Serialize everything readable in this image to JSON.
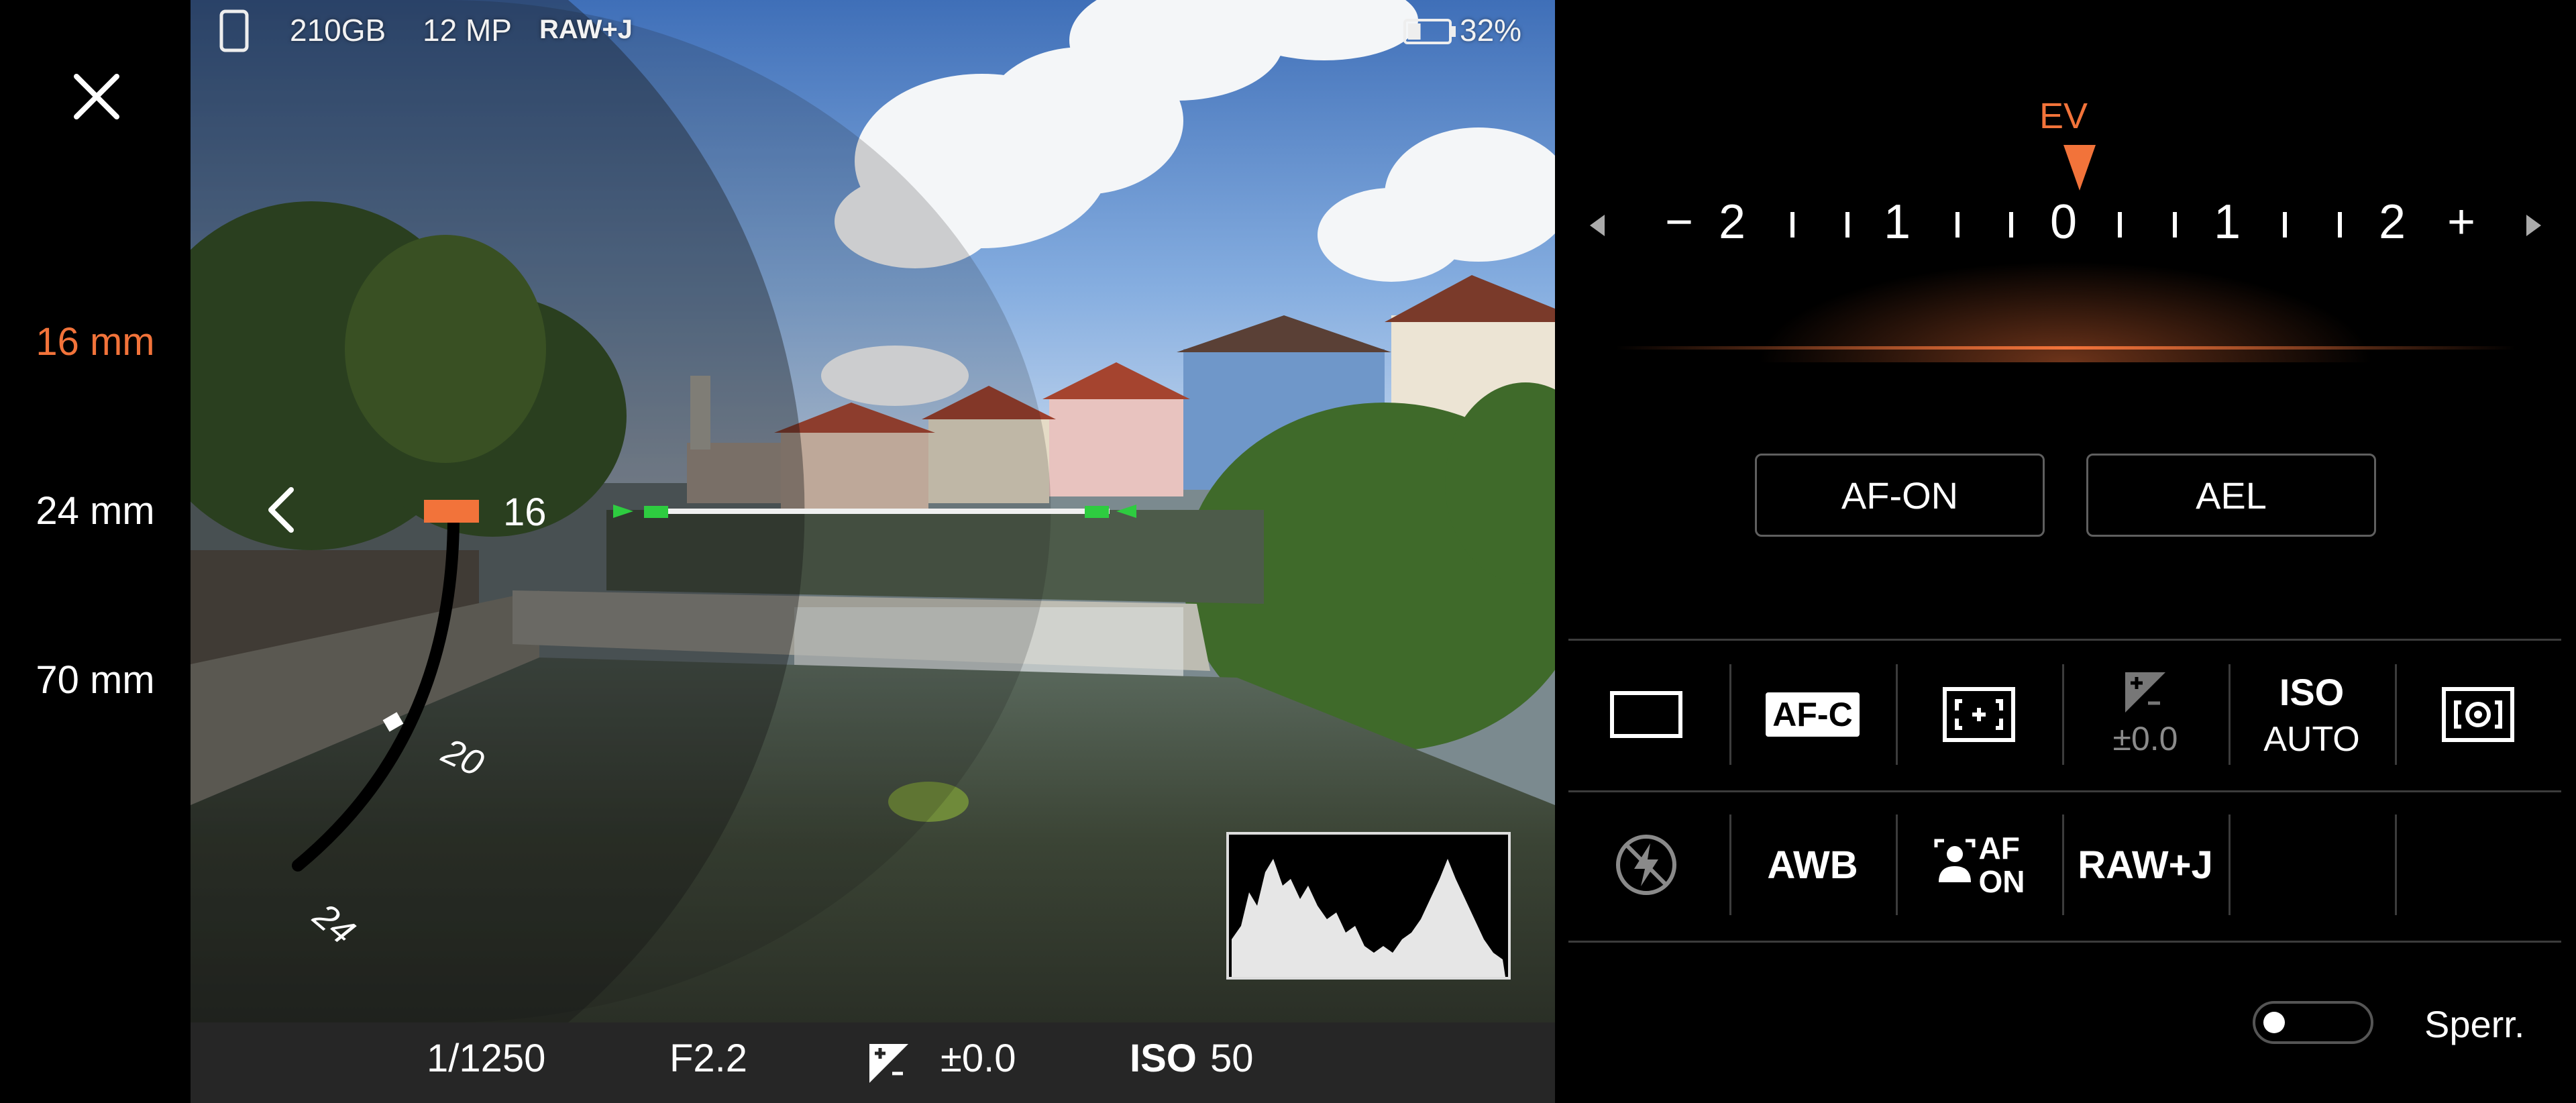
{
  "left_rail": {
    "close_icon": "close-icon",
    "focal_lengths": [
      {
        "label": "16 mm",
        "active": true
      },
      {
        "label": "24 mm",
        "active": false
      },
      {
        "label": "70 mm",
        "active": false
      }
    ]
  },
  "status": {
    "storage": "210GB",
    "resolution": "12 MP",
    "format": "RAW+J",
    "battery": "32%",
    "battery_level": 0.32
  },
  "zoom_dial": {
    "current": "16",
    "tick_20": "20",
    "tick_24": "24"
  },
  "bottom_bar": {
    "shutter": "1/1250",
    "aperture": "F2.2",
    "exposure": "±0.0",
    "iso_label": "ISO",
    "iso_value": "50"
  },
  "ev_scale": {
    "label": "EV",
    "minus": "−",
    "plus": "+",
    "numbers": [
      "2",
      "1",
      "0",
      "1",
      "2"
    ],
    "current": 0
  },
  "buttons": {
    "af_on": "AF-ON",
    "ael": "AEL"
  },
  "grid": {
    "row1": {
      "drive_mode_icon": "drive-mode-single-icon",
      "focus_mode": "AF-C",
      "focus_area_icon": "focus-area-icon",
      "exposure_value": "±0.0",
      "iso_label": "ISO",
      "iso_value": "AUTO",
      "metering_icon": "metering-icon"
    },
    "row2": {
      "flash_icon": "flash-off-icon",
      "white_balance": "AWB",
      "face_af_line1": "AF",
      "face_af_line2": "ON",
      "file_format": "RAW+J"
    }
  },
  "lock": {
    "label": "Sperr.",
    "on": false
  },
  "colors": {
    "accent": "#f2733a",
    "focus_green": "#2ecc40",
    "divider": "#3c3c3c"
  }
}
